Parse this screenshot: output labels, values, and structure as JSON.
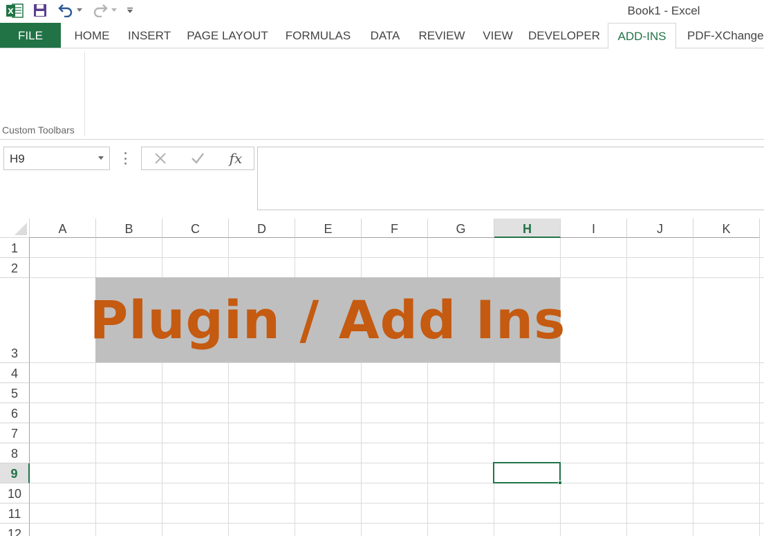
{
  "window": {
    "title": "Book1 - Excel"
  },
  "quick_access": {
    "app_icon": "excel-logo-icon",
    "icons": [
      "save-icon",
      "undo-icon",
      "redo-icon",
      "customize-qat-icon"
    ]
  },
  "ribbon": {
    "tabs": [
      {
        "label": "FILE",
        "active": false
      },
      {
        "label": "HOME",
        "active": false
      },
      {
        "label": "INSERT",
        "active": false
      },
      {
        "label": "PAGE LAYOUT",
        "active": false
      },
      {
        "label": "FORMULAS",
        "active": false
      },
      {
        "label": "DATA",
        "active": false
      },
      {
        "label": "REVIEW",
        "active": false
      },
      {
        "label": "VIEW",
        "active": false
      },
      {
        "label": "DEVELOPER",
        "active": false
      },
      {
        "label": "ADD-INS",
        "active": true
      },
      {
        "label": "PDF-XChange",
        "active": false
      }
    ],
    "groups": [
      {
        "label": "Custom Toolbars"
      }
    ]
  },
  "formula_bar": {
    "name_box": "H9",
    "fx_label": "fx",
    "formula": ""
  },
  "sheet": {
    "columns": [
      "A",
      "B",
      "C",
      "D",
      "E",
      "F",
      "G",
      "H",
      "I",
      "J",
      "K"
    ],
    "rows": [
      "1",
      "2",
      "3",
      "4",
      "5",
      "6",
      "7",
      "8",
      "9",
      "10",
      "11",
      "12"
    ],
    "selected_column": "H",
    "selected_row": "9",
    "banner": {
      "text": "Plugin / Add Ins",
      "text_color": "#c55a11",
      "fill_color": "#bfbfbf"
    }
  },
  "colors": {
    "accent": "#217346",
    "file_tab": "#217346"
  }
}
